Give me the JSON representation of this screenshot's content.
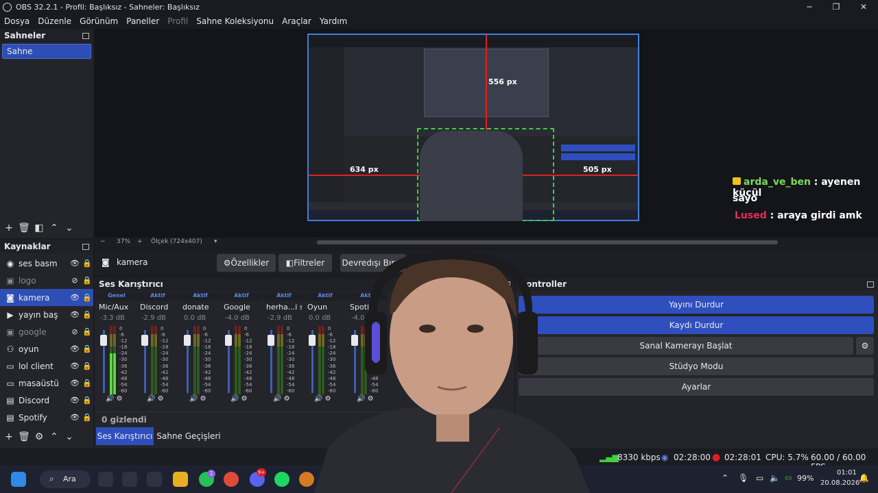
{
  "window": {
    "title": "OBS 32.2.1 - Profil: Başlıksız - Sahneler: Başlıksız",
    "min": "─",
    "max": "❐",
    "close": "✕"
  },
  "menu": [
    "Dosya",
    "Düzenle",
    "Görünüm",
    "Paneller",
    "Profil",
    "Sahne Koleksiyonu",
    "Araçlar",
    "Yardım"
  ],
  "scenes": {
    "header": "Sahneler",
    "items": [
      "Sahne"
    ]
  },
  "sources": {
    "header": "Kaynaklar",
    "items": [
      {
        "name": "ses basm",
        "icon": "speaker-icon",
        "glyph": "◉",
        "visible": true
      },
      {
        "name": "logo",
        "icon": "image-icon",
        "glyph": "▣",
        "visible": false
      },
      {
        "name": "kamera",
        "icon": "camera-icon",
        "glyph": "◙",
        "visible": true
      },
      {
        "name": "yayın baş",
        "icon": "play-icon",
        "glyph": "▶",
        "visible": true
      },
      {
        "name": "google",
        "icon": "image-icon",
        "glyph": "▣",
        "visible": false
      },
      {
        "name": "oyun",
        "icon": "gamepad-icon",
        "glyph": "⚇",
        "visible": true
      },
      {
        "name": "lol client",
        "icon": "window-icon",
        "glyph": "▭",
        "visible": true
      },
      {
        "name": "masaüstü",
        "icon": "monitor-icon",
        "glyph": "▭",
        "visible": true
      },
      {
        "name": "Discord",
        "icon": "window-icon",
        "glyph": "▤",
        "visible": true
      },
      {
        "name": "Spotify",
        "icon": "window-icon",
        "glyph": "▤",
        "visible": true
      }
    ]
  },
  "preview_bar": {
    "zoom": "37%",
    "scale": "Ölçek (724x407)",
    "minus": "−",
    "plus": "+"
  },
  "preview_labels": {
    "top": "556 px",
    "left": "634 px",
    "right": "505 px"
  },
  "source_toolbar": {
    "selected": "kamera",
    "properties": "Özellikler",
    "filters": "Filtreler",
    "disable": "Devredışı Bırak"
  },
  "mixer": {
    "header": "Ses Karıştırıcı",
    "hidden": "0 gizlendi",
    "scale": [
      "0",
      "-6",
      "-12",
      "-18",
      "-24",
      "-30",
      "-36",
      "-42",
      "-48",
      "-54",
      "-60"
    ],
    "channels": [
      {
        "state": "Genel",
        "name": "Mic/Aux",
        "db": "-3.3 dB",
        "level": 0.6
      },
      {
        "state": "Aktif",
        "name": "Discord",
        "db": "-2.9 dB",
        "level": 0.0
      },
      {
        "state": "Aktif",
        "name": "donate",
        "db": "0.0 dB",
        "level": 0.0
      },
      {
        "state": "Aktif",
        "name": "Google",
        "db": "-4.0 dB",
        "level": 0.0
      },
      {
        "state": "Aktif",
        "name": "herha...i ses",
        "db": "-2.9 dB",
        "level": 0.0
      },
      {
        "state": "Aktif",
        "name": "Oyun",
        "db": "0.0 dB",
        "level": 0.0
      },
      {
        "state": "Aktif",
        "name": "Spotify",
        "db": "-4.0 dB",
        "level": 0.0
      }
    ]
  },
  "bottom_tabs": [
    "Ses Karıştırıcı",
    "Sahne Geçişleri"
  ],
  "controls": {
    "header": "Kontroller",
    "buttons": [
      "Yayını Durdur",
      "Kaydı Durdur",
      "Sanal Kamerayı Başlat",
      "Stüdyo Modu",
      "Ayarlar"
    ],
    "accent": "#2f4fbf"
  },
  "chat": [
    {
      "user": "arda_ve_ben",
      "text": " : ayenen küçül",
      "text2": "sayo",
      "color": "#7ddc5a"
    },
    {
      "user": "Lused",
      "text": " : araya girdi amk",
      "color": "#e0305a"
    }
  ],
  "status": {
    "bitrate": "8330 kbps",
    "stream_time": "02:28:00",
    "rec_time": "02:28:01",
    "cpu": "CPU: 5.7%",
    "fps": "60.00 / 60.00 FPS"
  },
  "taskbar": {
    "search": "Ara",
    "battery": "99%",
    "time": "01:01",
    "date": "20.08.2026",
    "notif_badge": "1",
    "discord_badge": "9+"
  }
}
